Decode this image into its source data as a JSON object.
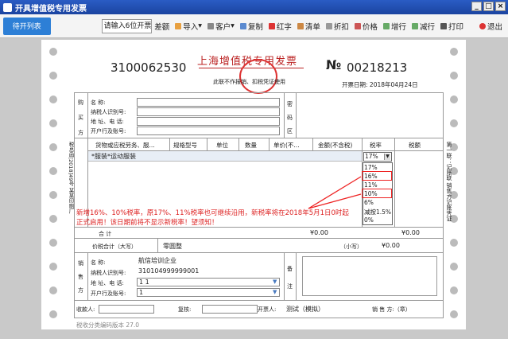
{
  "window": {
    "title": "开具增值税专用发票"
  },
  "toolbar": {
    "pending_list": "待开列表",
    "input_value": "请输入6位开票代码",
    "items": [
      "差额",
      "导入",
      "客户",
      "复制",
      "红字",
      "清单",
      "折扣",
      "价格",
      "增行",
      "减行",
      "打印",
      "退出"
    ]
  },
  "invoice": {
    "code": "3100062530",
    "title": "上海增值税专用发票",
    "subtitle": "此联不作报销、扣税凭证使用",
    "number_symbol": "№",
    "number": "00218213",
    "date_label": "开票日期:",
    "date": "2018年04月24日",
    "buyer": {
      "section": [
        "购",
        "买",
        "方"
      ],
      "labels": [
        "名    称:",
        "纳税人识别号:",
        "地 址、电 话:",
        "开户行及账号:"
      ]
    },
    "password_area": [
      "密",
      "码",
      "区"
    ],
    "left_side_text": "税总函[2018]49号 某某印刷厂",
    "right_side_text": "第一联：记账联 销售方记账凭证",
    "table_headers": [
      "货物或应税劳务、服...",
      "规格型号",
      "单位",
      "数量",
      "单价(不...",
      "金额(不含税)",
      "税率",
      "税额"
    ],
    "item_name": "*服装*运动服装",
    "tax_rate_selected": "17%",
    "tax_rate_options": [
      "17%",
      "16%",
      "11%",
      "10%",
      "6%",
      "减按1.5%",
      "0%"
    ],
    "notice_line1": "新增16%、10%税率，原17%、11%税率也可继续沿用，新税率将在2018年5月1日0时起",
    "notice_line2": "正式启用！该日期前将不显示新税率！望须知！",
    "total_label": "合          计",
    "total_amount": "¥0.00",
    "total_tax": "¥0.00",
    "total_words_label": "价税合计（大写）",
    "total_words": "零圆整",
    "total_small_label": "（小写）",
    "total_small": "¥0.00",
    "seller": {
      "section": [
        "销",
        "售",
        "方"
      ],
      "labels": [
        "名    称:",
        "纳税人识别号:",
        "地 址、电 话:",
        "开户行及账号:"
      ],
      "name": "航信培训企业",
      "tax_id": "310104999999001",
      "address_phone": "1 1",
      "bank_account": "1"
    },
    "remarks": [
      "备",
      "注"
    ],
    "payee_label": "收款人:",
    "reviewer_label": "复核:",
    "drawer_label": "开票人:",
    "drawer": "测试（模拟）",
    "seller_seal_label": "销  售  方:（章）",
    "version": "税收分类编码版本 27.0"
  }
}
